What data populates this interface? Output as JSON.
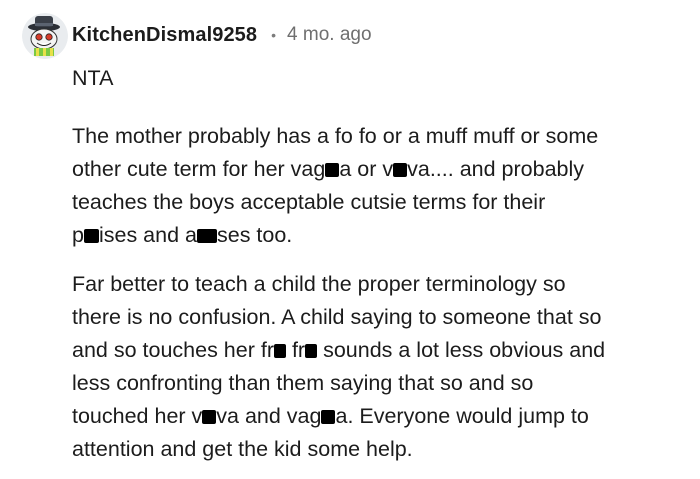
{
  "comment": {
    "username": "KitchenDismal9258",
    "separator": "•",
    "age": "4 mo. ago",
    "paragraphs": {
      "p1": "NTA",
      "p2": {
        "t1": "The mother probably has a fo fo or a muff muff or some",
        "t2": "other cute term for her vag",
        "t3": "a or v",
        "t4": "va.... and probably",
        "t5": "teaches the boys acceptable cutsie terms for their",
        "t6": "p",
        "t7": "ises and a",
        "t8": "ses too."
      },
      "p3": {
        "t1": "Far better to teach a child the proper terminology so",
        "t2": "there is no confusion. A child saying to someone that so",
        "t3": "and so touches her fr",
        "t4": " fr",
        "t5": " sounds a lot less obvious and",
        "t6": "less confronting than them saying that so and so",
        "t7": "touched her v",
        "t8": "va and vag",
        "t9": "a. Everyone would jump to",
        "t10": "attention and get the kid some help."
      }
    }
  },
  "colors": {
    "text": "#1c1c1c",
    "meta": "#6f6f6f",
    "censor": "#000000"
  },
  "icons": {
    "avatar": "snoo-avatar-with-hat"
  }
}
